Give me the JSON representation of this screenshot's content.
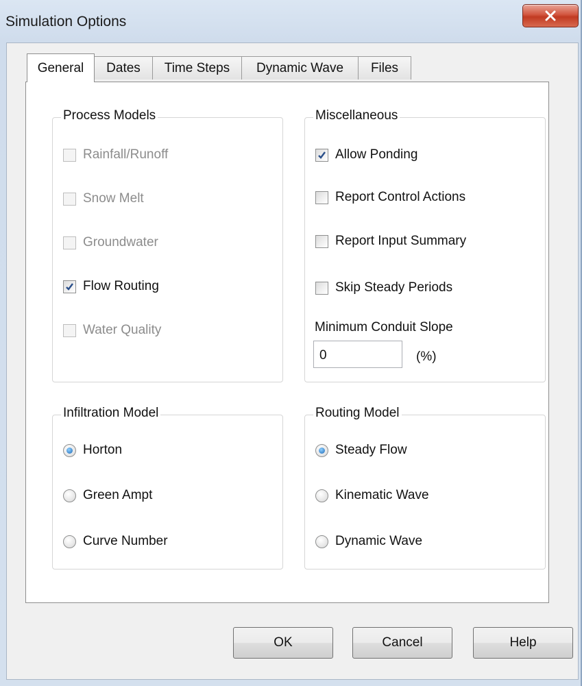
{
  "window": {
    "title": "Simulation Options"
  },
  "tabs": [
    {
      "label": "General",
      "active": true
    },
    {
      "label": "Dates"
    },
    {
      "label": "Time Steps"
    },
    {
      "label": "Dynamic Wave"
    },
    {
      "label": "Files"
    }
  ],
  "process_models": {
    "title": "Process Models",
    "items": [
      {
        "label": "Rainfall/Runoff",
        "checked": false,
        "enabled": false
      },
      {
        "label": "Snow Melt",
        "checked": false,
        "enabled": false
      },
      {
        "label": "Groundwater",
        "checked": false,
        "enabled": false
      },
      {
        "label": "Flow Routing",
        "checked": true,
        "enabled": true
      },
      {
        "label": "Water Quality",
        "checked": false,
        "enabled": false
      }
    ]
  },
  "miscellaneous": {
    "title": "Miscellaneous",
    "items": [
      {
        "label": "Allow Ponding",
        "checked": true
      },
      {
        "label": "Report Control Actions",
        "checked": false
      },
      {
        "label": "Report Input Summary",
        "checked": false
      },
      {
        "label": "Skip Steady Periods",
        "checked": false
      }
    ],
    "min_slope_label": "Minimum Conduit Slope",
    "min_slope_value": "0",
    "min_slope_unit": "(%)"
  },
  "infiltration_model": {
    "title": "Infiltration Model",
    "options": [
      {
        "label": "Horton",
        "selected": true
      },
      {
        "label": "Green Ampt",
        "selected": false
      },
      {
        "label": "Curve Number",
        "selected": false
      }
    ]
  },
  "routing_model": {
    "title": "Routing Model",
    "options": [
      {
        "label": "Steady Flow",
        "selected": true
      },
      {
        "label": "Kinematic Wave",
        "selected": false
      },
      {
        "label": "Dynamic Wave",
        "selected": false
      }
    ]
  },
  "buttons": {
    "ok": "OK",
    "cancel": "Cancel",
    "help": "Help"
  }
}
